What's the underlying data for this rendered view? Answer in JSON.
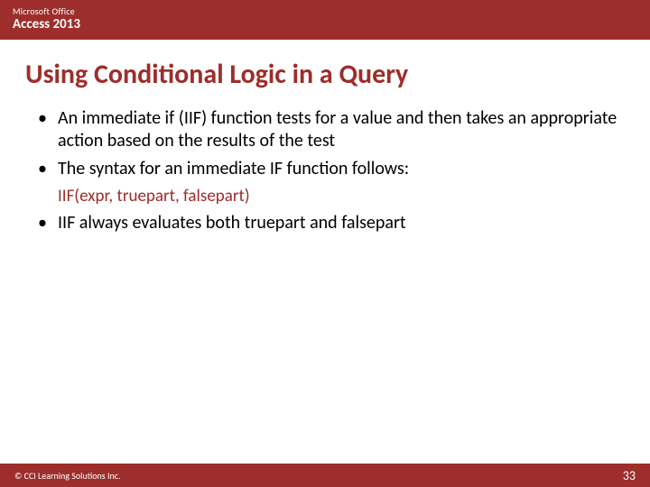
{
  "header": {
    "brand": "Microsoft Office",
    "product": "Access 2013"
  },
  "title": "Using Conditional Logic in a Query",
  "bullets": [
    "An immediate if (IIF) function tests for a value and then takes an appropriate action based on the results of the test",
    "The syntax for an immediate IF function follows:",
    "IIF always evaluates both truepart and falsepart"
  ],
  "syntax": "IIF(expr, truepart, falsepart)",
  "footer": {
    "copyright": "© CCI Learning Solutions Inc.",
    "page": "33"
  }
}
